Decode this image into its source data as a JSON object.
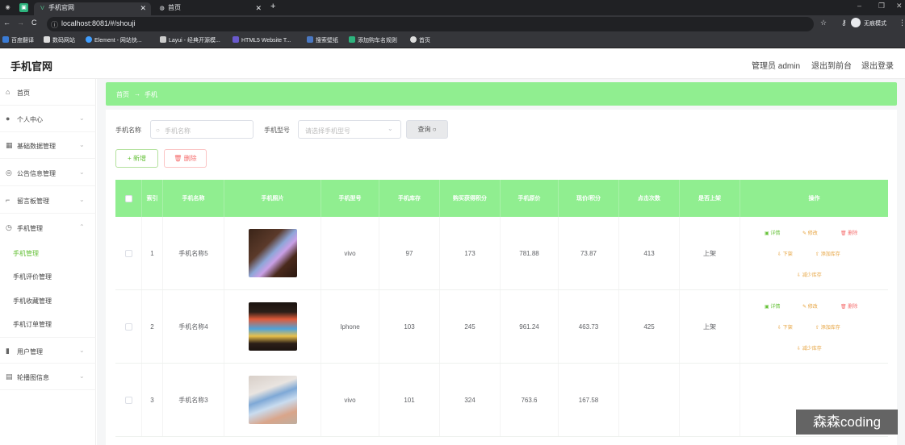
{
  "browser": {
    "tabs": [
      {
        "label": "手机官网",
        "active": true
      },
      {
        "label": "首页",
        "active": false
      }
    ],
    "new_tab": "+",
    "nav": {
      "back": "←",
      "forward": "→",
      "reload": "C"
    },
    "url": "localhost:8081/#/shouji",
    "profile_label": "无痕模式",
    "bookmarks": [
      "百度翻译",
      "数码网站",
      "Element - 网站快...",
      "Layui - 经典开源模...",
      "HTML5 Website T...",
      "搜索壁纸",
      "添加购车名规则",
      "首页"
    ]
  },
  "header": {
    "logo": "手机官网",
    "admin_label": "管理员 admin",
    "front_link": "退出到前台",
    "logout_link": "退出登录"
  },
  "sidebar": {
    "items": [
      {
        "label": "首页",
        "icon": "home-icon"
      },
      {
        "label": "个人中心",
        "icon": "user-icon"
      },
      {
        "label": "基础数据管理",
        "icon": "grid-icon"
      },
      {
        "label": "公告信息管理",
        "icon": "notice-icon"
      },
      {
        "label": "留言板管理",
        "icon": "message-icon"
      },
      {
        "label": "手机管理",
        "icon": "phone-icon"
      }
    ],
    "sub_items": [
      "手机管理",
      "手机评价管理",
      "手机收藏管理",
      "手机订单管理"
    ],
    "items_after": [
      {
        "label": "用户管理",
        "icon": "chart-icon"
      },
      {
        "label": "轮播图信息",
        "icon": "image-icon"
      }
    ]
  },
  "breadcrumb": {
    "home": "首页",
    "arrow": "→",
    "current": "手机"
  },
  "search": {
    "name_label": "手机名称",
    "name_placeholder": "手机名称",
    "type_label": "手机型号",
    "type_placeholder": "请选择手机型号",
    "search_button": "查询"
  },
  "actions": {
    "add": "新增",
    "delete": "删除"
  },
  "table": {
    "headers": [
      "索引",
      "手机名称",
      "手机照片",
      "手机型号",
      "手机库存",
      "购买获得积分",
      "手机原价",
      "现价/积分",
      "点击次数",
      "是否上架",
      "操作"
    ],
    "rows": [
      {
        "index": "1",
        "name": "手机名称5",
        "model": "vivo",
        "stock": "97",
        "points": "173",
        "price": "781.88",
        "now": "73.87",
        "clicks": "413",
        "status": "上架"
      },
      {
        "index": "2",
        "name": "手机名称4",
        "model": "Iphone",
        "stock": "103",
        "points": "245",
        "price": "961.24",
        "now": "463.73",
        "clicks": "425",
        "status": "上架"
      },
      {
        "index": "3",
        "name": "手机名称3",
        "model": "vivo",
        "stock": "101",
        "points": "324",
        "price": "763.6",
        "now": "167.58",
        "clicks": "",
        "status": ""
      }
    ],
    "ops": {
      "detail": "详情",
      "edit": "修改",
      "remove": "删除",
      "off": "下架",
      "add_stock": "添加库存",
      "reduce_stock": "减少库存"
    }
  },
  "watermark": "森森coding",
  "colors": {
    "accent": "#90ee90",
    "active_text": "#67c23a",
    "danger": "#f56c6c",
    "warning": "#e6a23c"
  }
}
